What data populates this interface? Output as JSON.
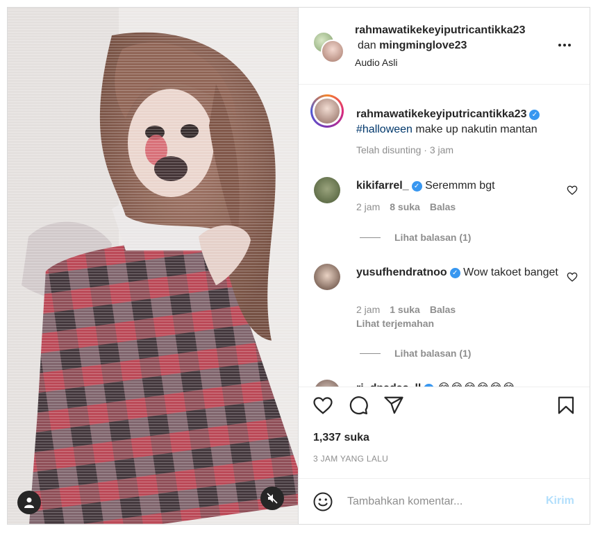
{
  "header": {
    "username": "rahmawatikekeyiputricantikka23",
    "and_word": "dan",
    "collab_username": "mingminglove23",
    "audio": "Audio Asli"
  },
  "caption": {
    "username": "rahmawatikekeyiputricantikka23",
    "hashtag": "#halloween",
    "text": " make up nakutin mantan",
    "meta": "Telah disunting · 3 jam"
  },
  "comments": [
    {
      "username": "kikifarrel_",
      "text": "Seremmm bgt",
      "time": "2 jam",
      "likes": "8 suka",
      "reply": "Balas",
      "view_replies": "Lihat balasan (1)"
    },
    {
      "username": "yusufhendratnoo",
      "text": "Wow takoet banget",
      "time": "2 jam",
      "likes": "1 suka",
      "reply": "Balas",
      "translate": "Lihat terjemahan",
      "view_replies": "Lihat balasan (1)"
    },
    {
      "username": "ri_dnadas_ll",
      "text": "😂😂😂😂😂😂"
    }
  ],
  "post": {
    "likes": "1,337 suka",
    "time": "3 JAM YANG LALU"
  },
  "comment_box": {
    "placeholder": "Tambahkan komentar...",
    "post_label": "Kirim"
  },
  "colors": {
    "accent": "#0095f6",
    "post_disabled": "#b2dffc",
    "verified": "#3897f0",
    "hashtag": "#00376b"
  },
  "icons": {
    "like": "heart-icon",
    "comment": "comment-icon",
    "share": "paper-plane-icon",
    "save": "bookmark-icon",
    "emoji": "smiley-icon",
    "more": "more-horizontal-icon",
    "tagged": "user-icon",
    "sound": "muted-speaker-icon"
  }
}
